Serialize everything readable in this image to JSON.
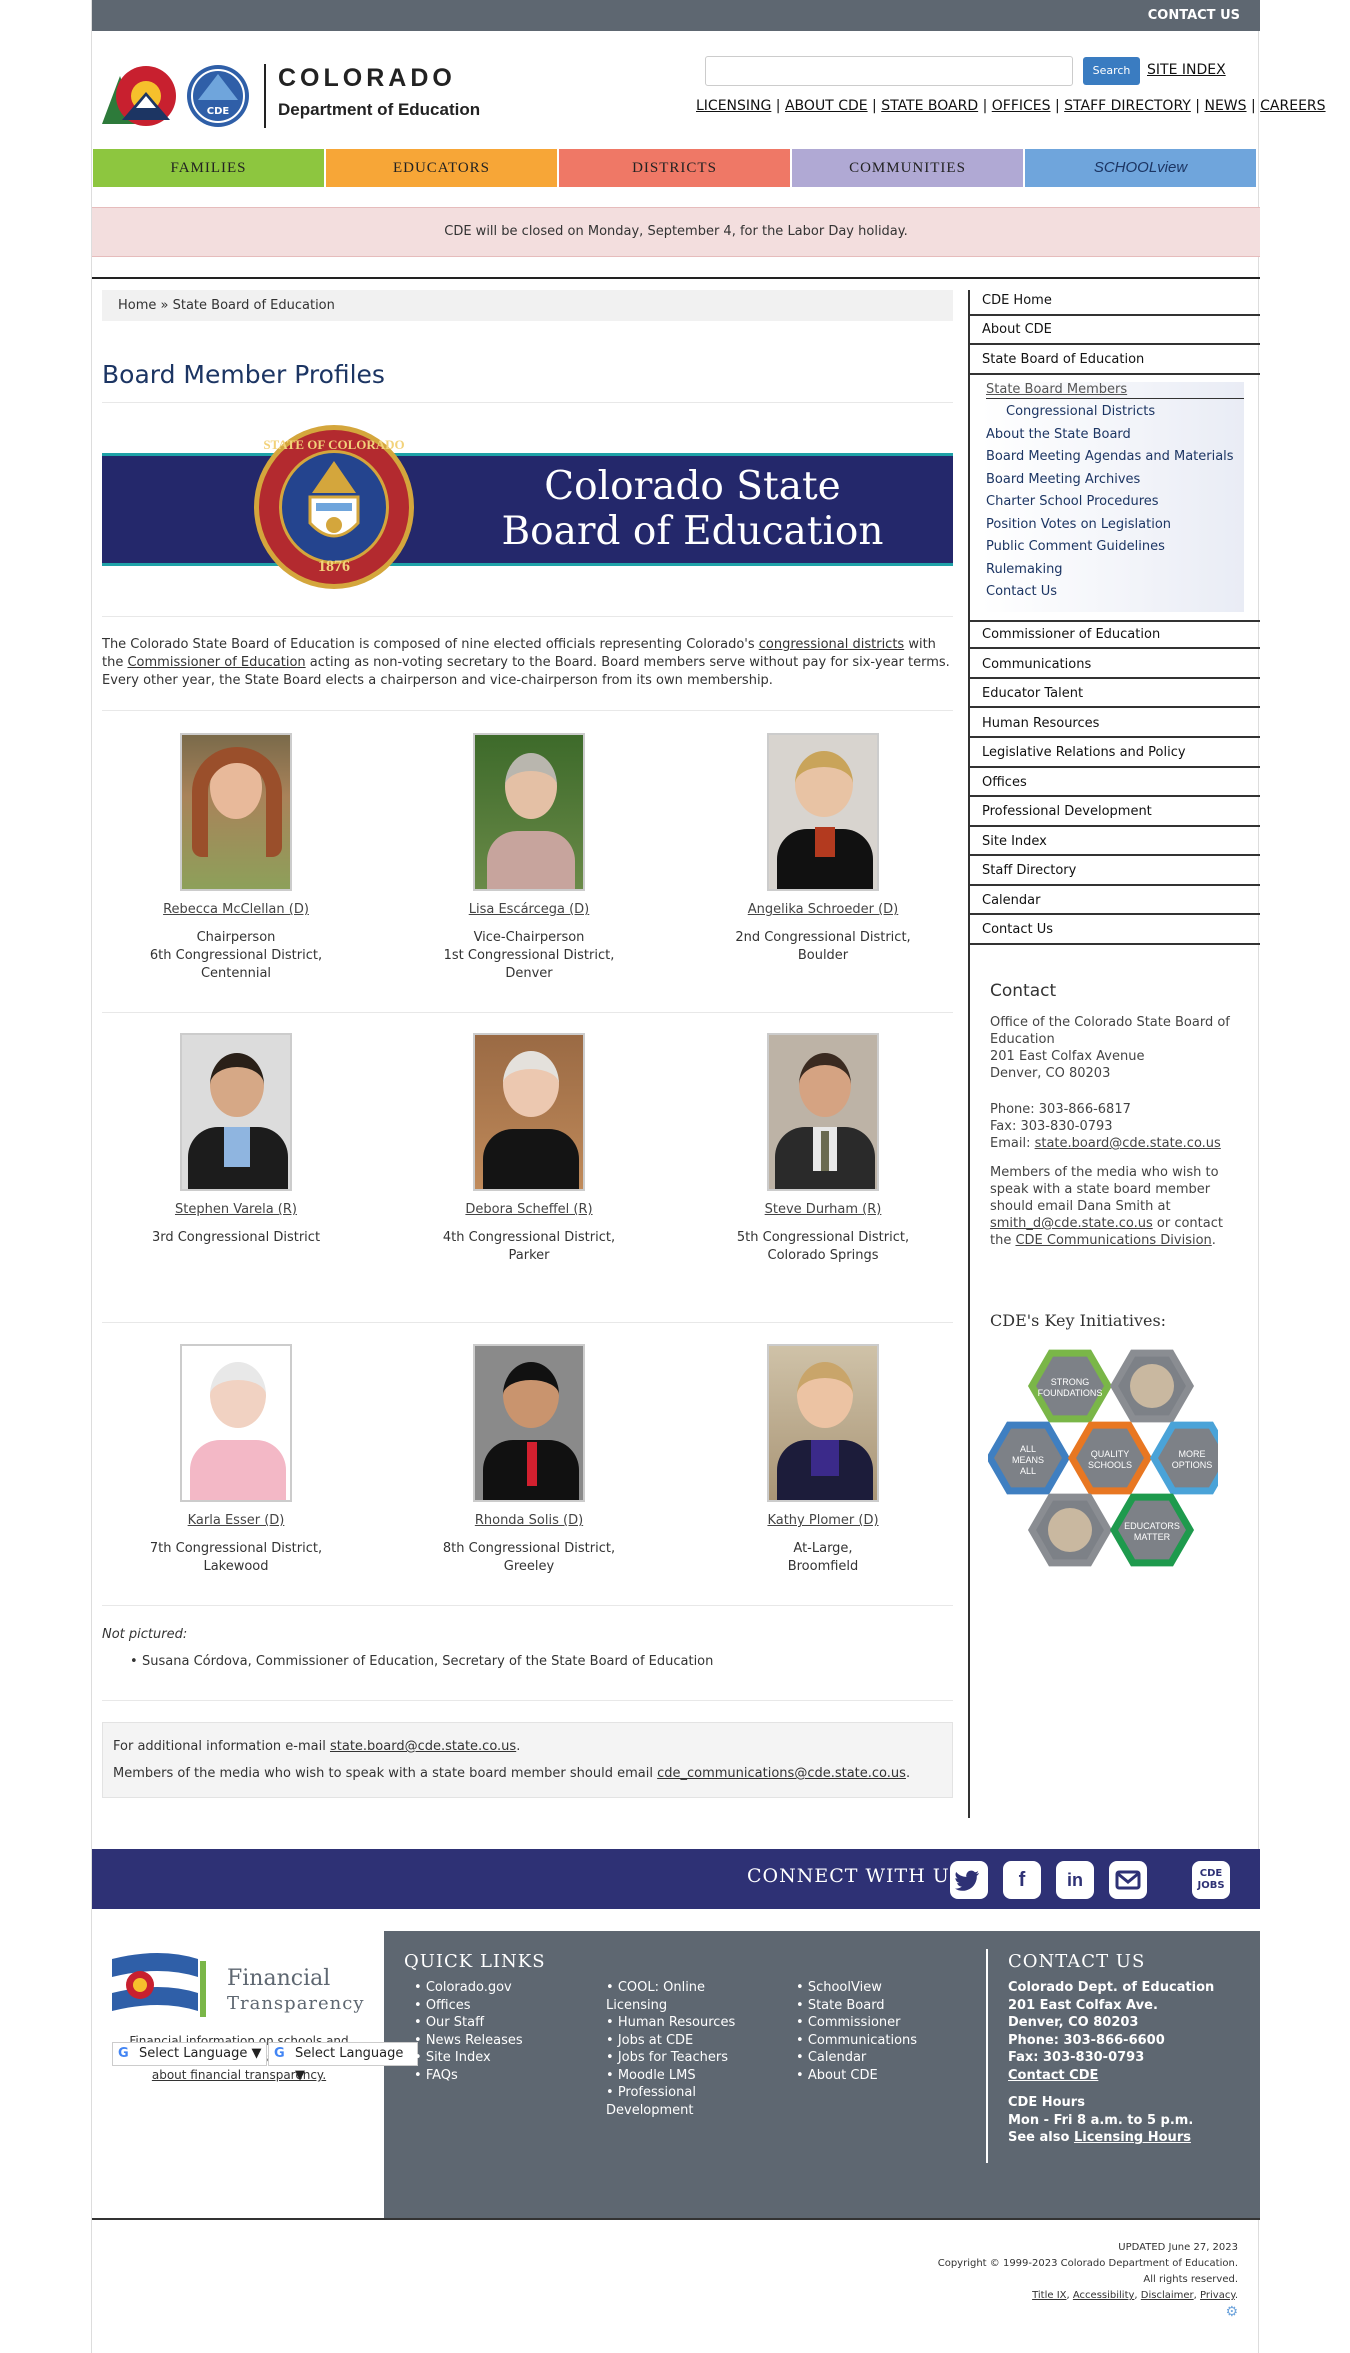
{
  "header": {
    "contact_us": "CONTACT US",
    "logo_title": "COLORADO",
    "logo_subtitle": "Department of Education",
    "logo_badge": "CDE",
    "search_placeholder": "",
    "search_button": "Search",
    "site_index": "SITE INDEX",
    "top_links": [
      "LICENSING",
      "ABOUT CDE",
      "STATE BOARD",
      "OFFICES",
      "STAFF DIRECTORY",
      "NEWS",
      "CAREERS"
    ]
  },
  "nav": {
    "items": [
      {
        "label": "FAMILIES",
        "color": "#8dc63f"
      },
      {
        "label": "EDUCATORS",
        "color": "#f7a637"
      },
      {
        "label": "DISTRICTS",
        "color": "#ef7866"
      },
      {
        "label": "COMMUNITIES",
        "color": "#b0a9d4"
      },
      {
        "label": "SCHOOLview",
        "color": "#6fa5dc"
      }
    ]
  },
  "alert": "CDE will be closed on Monday, September 4, for the Labor Day holiday.",
  "breadcrumb": "Home » State Board of Education",
  "page_title": "Board Member Profiles",
  "banner": {
    "line1": "Colorado State",
    "line2": "Board of Education",
    "seal_top": "STATE OF COLORADO",
    "seal_year": "1876"
  },
  "intro": {
    "part1": "The Colorado State Board of Education is composed of nine elected officials representing Colorado's ",
    "link1": "congressional districts",
    "part2": " with the ",
    "link2": "Commissioner of Education",
    "part3": " acting as non-voting secretary to the Board. Board members serve without pay for six-year terms. Every other year, the State Board elects a chairperson and vice-chairperson from its own membership."
  },
  "members": [
    {
      "name": "Rebecca McClellan (D)",
      "role": "Chairperson",
      "district": "6th Congressional District,",
      "city": "Centennial"
    },
    {
      "name": "Lisa Escárcega (D)",
      "role": "Vice-Chairperson",
      "district": "1st Congressional District,",
      "city": "Denver"
    },
    {
      "name": "Angelika Schroeder (D)",
      "role": "",
      "district": "2nd Congressional District,",
      "city": "Boulder"
    },
    {
      "name": "Stephen Varela (R)",
      "role": "",
      "district": "3rd Congressional District",
      "city": ""
    },
    {
      "name": "Debora Scheffel (R)",
      "role": "",
      "district": "4th Congressional District,",
      "city": "Parker"
    },
    {
      "name": "Steve Durham (R)",
      "role": "",
      "district": "5th Congressional District,",
      "city": "Colorado Springs"
    },
    {
      "name": "Karla Esser (D)",
      "role": "",
      "district": "7th Congressional District,",
      "city": "Lakewood"
    },
    {
      "name": "Rhonda Solis (D)",
      "role": "",
      "district": "8th Congressional District,",
      "city": "Greeley"
    },
    {
      "name": "Kathy Plomer (D)",
      "role": "",
      "district": "At-Large,",
      "city": "Broomfield"
    }
  ],
  "not_pictured": {
    "label": "Not pictured:",
    "item": "Susana Córdova, Commissioner of Education, Secretary of the State Board of Education"
  },
  "info": {
    "line1_pre": "For additional information e-mail ",
    "line1_email": "state.board@cde.state.co.us",
    "line1_post": ".",
    "line2_pre": "Members of the media who wish to speak with a state board member should email ",
    "line2_email": "cde_communications@cde.state.co.us",
    "line2_post": "."
  },
  "sidebar": {
    "top": [
      "CDE Home",
      "About CDE",
      "State Board of Education"
    ],
    "sub": [
      "State Board Members",
      "Congressional Districts",
      "About the State Board",
      "Board Meeting Agendas and Materials",
      "Board Meeting Archives",
      "Charter School Procedures",
      "Position Votes on Legislation",
      "Public Comment Guidelines",
      "Rulemaking",
      "Contact Us"
    ],
    "bottom": [
      "Commissioner of Education",
      "Communications",
      "Educator Talent",
      "Human Resources",
      "Legislative Relations and Policy",
      "Offices",
      "Professional Development",
      "Site Index",
      "Staff Directory",
      "Calendar",
      "Contact Us"
    ]
  },
  "contact": {
    "title": "Contact",
    "office": "Office of the Colorado State Board of Education",
    "street": "201 East Colfax Avenue",
    "city": "Denver, CO 80203",
    "phone": "Phone: 303-866-6817",
    "fax": "Fax: 303-830-0793",
    "email_label": "Email: ",
    "email": "state.board@cde.state.co.us",
    "media_pre": "Members of the media who wish to speak with a state board member should email Dana Smith at ",
    "media_email": "smith_d@cde.state.co.us",
    "media_mid": " or contact the ",
    "media_link": "CDE Communications Division",
    "media_post": "."
  },
  "initiatives": {
    "title": "CDE's Key Initiatives:",
    "hexes": [
      {
        "label": "STRONG FOUNDATIONS",
        "color": "#7ab648"
      },
      {
        "label": "",
        "color": "#8a8d92"
      },
      {
        "label": "ALL MEANS ALL",
        "color": "#3f7fc1"
      },
      {
        "label": "QUALITY SCHOOLS",
        "color": "#e87722"
      },
      {
        "label": "MORE OPTIONS",
        "color": "#4aa3d8"
      },
      {
        "label": "",
        "color": "#8a8d92"
      },
      {
        "label": "EDUCATORS MATTER",
        "color": "#1e9a4d"
      }
    ]
  },
  "connect": {
    "label": "CONNECT WITH US",
    "icons": [
      "twitter-icon",
      "facebook-icon",
      "linkedin-icon",
      "email-icon",
      "cde-jobs-icon"
    ],
    "jobs_text": "CDE JOBS"
  },
  "footer": {
    "ft_title": "Financial",
    "ft_sub": "Transparency",
    "ft_desc_pre": "Financial information on schools and districts throughout Colorado. ",
    "ft_desc_link": "Learn more about financial transparency.",
    "select_language": "Select Language",
    "quick_links_title": "QUICK LINKS",
    "col1": [
      "Colorado.gov",
      "Offices",
      "Our Staff",
      "News Releases",
      "Site Index",
      "FAQs"
    ],
    "col2": [
      "COOL: Online Licensing",
      "Human Resources",
      "Jobs at CDE",
      "Jobs for Teachers",
      "Moodle LMS",
      "Professional Development"
    ],
    "col3": [
      "SchoolView",
      "State Board",
      "Commissioner",
      "Communications",
      "Calendar",
      "About CDE"
    ],
    "contact_title": "CONTACT US",
    "contact_lines": [
      "Colorado Dept. of Education",
      "201 East Colfax Ave.",
      "Denver, CO 80203",
      "Phone: 303-866-6600",
      "Fax: 303-830-0793"
    ],
    "contact_link": "Contact CDE",
    "hours_title": "CDE Hours",
    "hours": "Mon - Fri 8 a.m. to 5 p.m.",
    "see_also": "See also ",
    "licensing_hours": "Licensing Hours"
  },
  "bottom": {
    "updated": "UPDATED June 27, 2023",
    "copyright": "Copyright © 1999-2023 Colorado Department of Education.",
    "rights": "All rights reserved.",
    "links": [
      "Title IX",
      "Accessibility",
      "Disclaimer",
      "Privacy"
    ]
  }
}
